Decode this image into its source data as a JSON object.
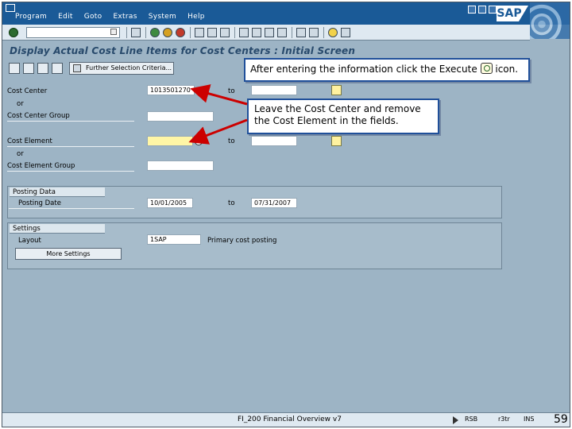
{
  "menubar": {
    "items": [
      "Program",
      "Edit",
      "Goto",
      "Extras",
      "System",
      "Help"
    ],
    "logo_text": "SAP"
  },
  "title": "Display Actual Cost Line Items for Cost Centers : Initial Screen",
  "app_toolbar": {
    "further_selection_label": "Further Selection Criteria..."
  },
  "fields": {
    "cost_center_label": "Cost Center",
    "cost_center_value": "1013501270",
    "to_label": "to",
    "or_label_1": "or",
    "cost_center_group_label": "Cost Center Group",
    "cost_element_label": "Cost Element",
    "or_label_2": "or",
    "cost_element_group_label": "Cost Element Group"
  },
  "posting_data": {
    "group_title": "Posting Data",
    "posting_date_label": "Posting Date",
    "posting_date_from": "10/01/2005",
    "to_label": "to",
    "posting_date_to": "07/31/2007"
  },
  "settings": {
    "group_title": "Settings",
    "layout_label": "Layout",
    "layout_value": "1SAP",
    "layout_description": "Primary cost posting",
    "more_settings_label": "More Settings"
  },
  "callouts": {
    "execute_before": "After entering the information click the Execute",
    "execute_after": "icon.",
    "leave_cost_center": "Leave the Cost Center and remove the Cost Element in the fields."
  },
  "statusbar": {
    "text": "FI_200 Financial Overview v7",
    "system": "RSB",
    "client": "r3tr",
    "mode": "INS"
  },
  "page_number": "59",
  "colors": {
    "menubar": "#1a5a97",
    "background": "#9db4c5",
    "callout_border": "#20509a",
    "arrow": "#cc0000"
  }
}
